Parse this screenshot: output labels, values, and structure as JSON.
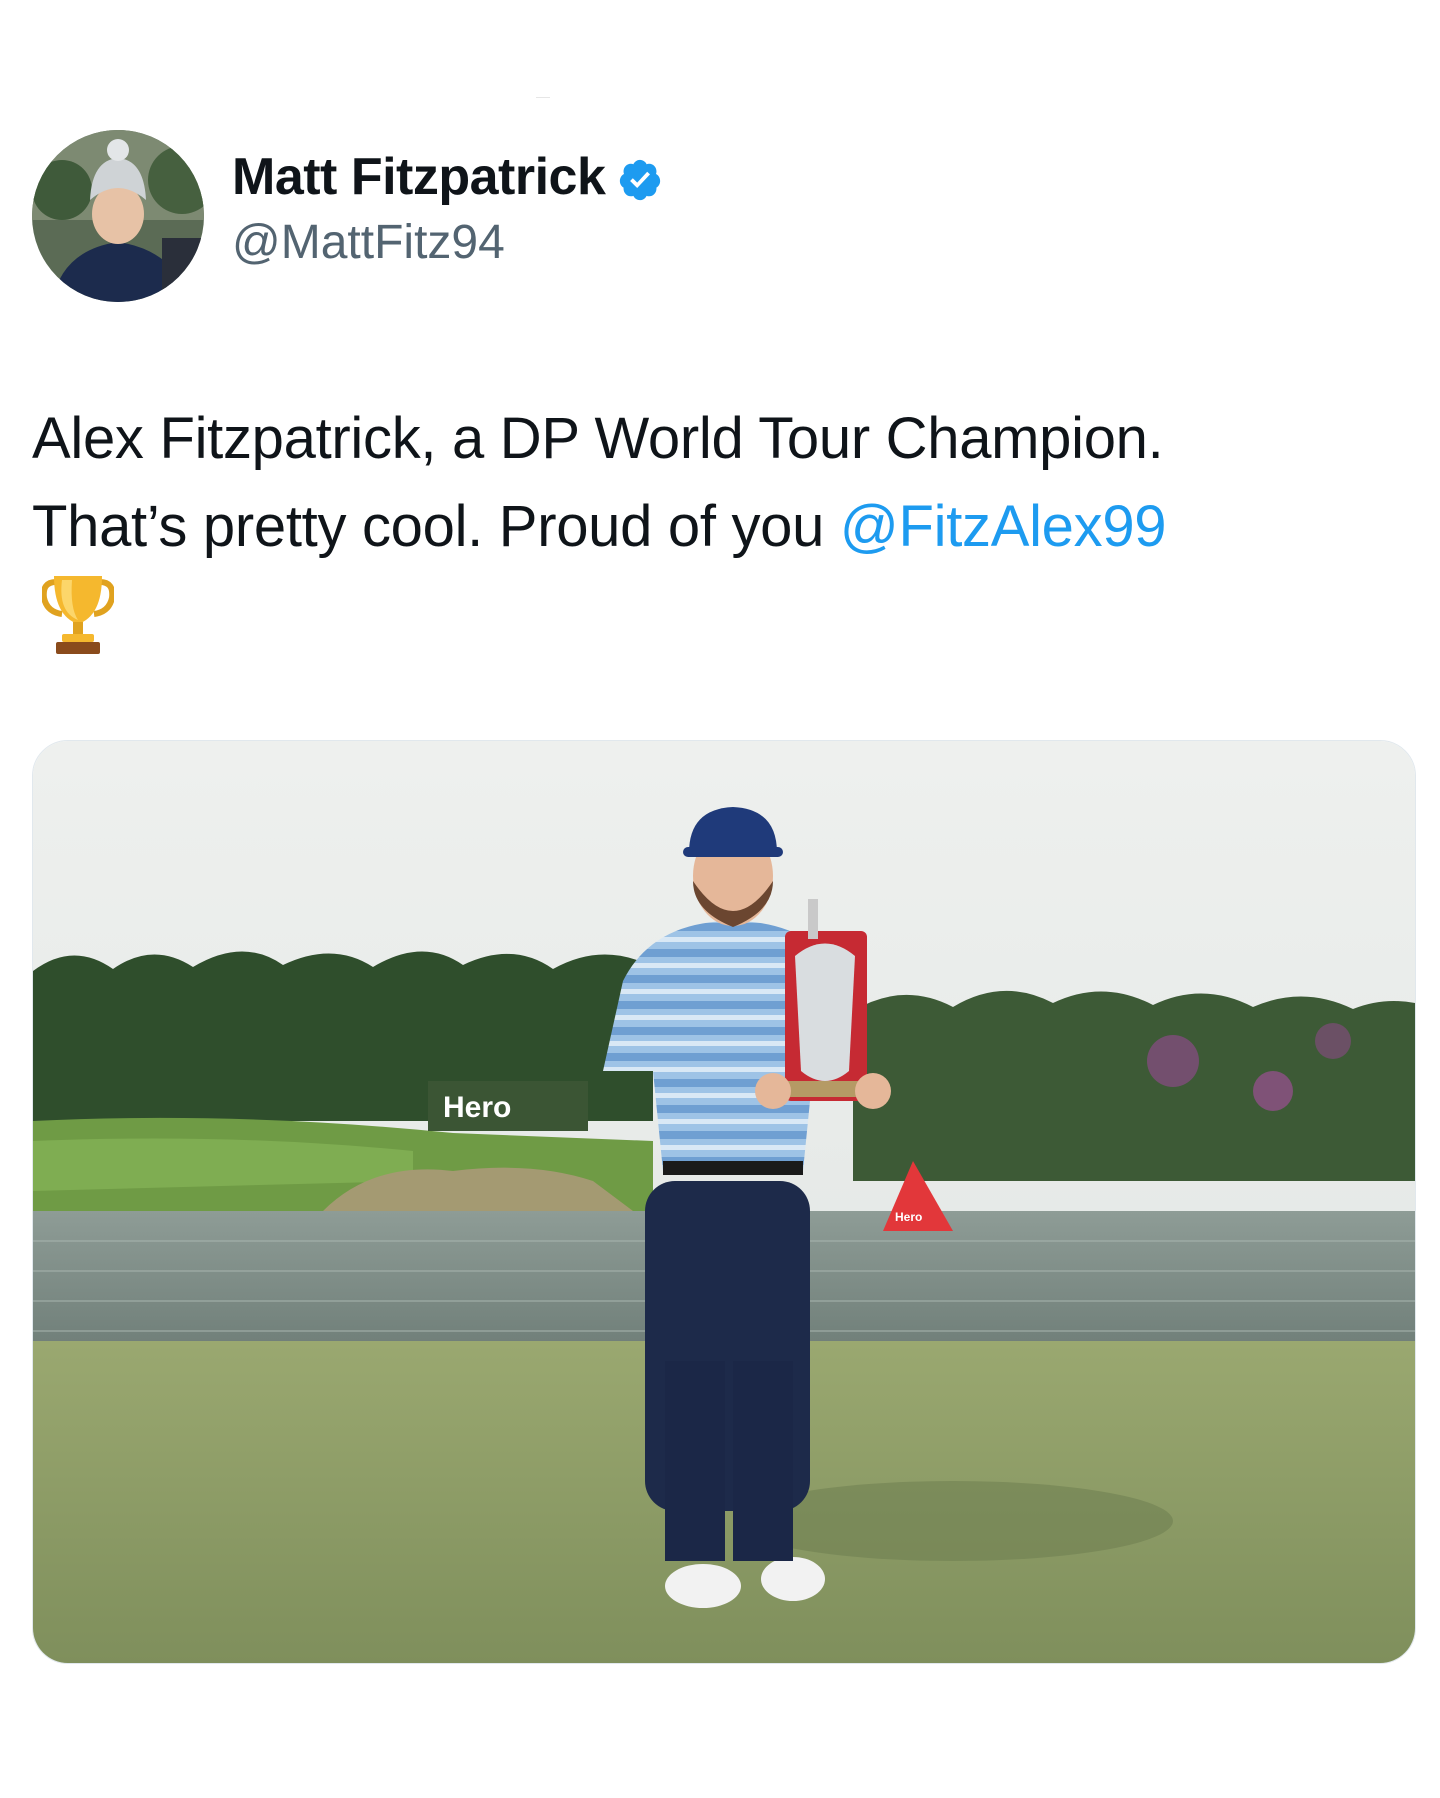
{
  "author": {
    "display_name": "Matt Fitzpatrick",
    "handle": "@MattFitz94",
    "verified": true,
    "avatar_icon": "profile-photo"
  },
  "tweet": {
    "text_line1": "Alex Fitzpatrick, a DP World Tour Champion.",
    "text_line2_prefix": "That’s pretty cool. Proud of you ",
    "mention": "@FitzAlex99",
    "emoji": "trophy-emoji"
  },
  "media": {
    "sponsor_board_text": "Hero",
    "buoy_text": "Hero"
  },
  "colors": {
    "accent": "#1d9bf0",
    "secondary_text": "#536471",
    "primary_text": "#0f1419"
  }
}
